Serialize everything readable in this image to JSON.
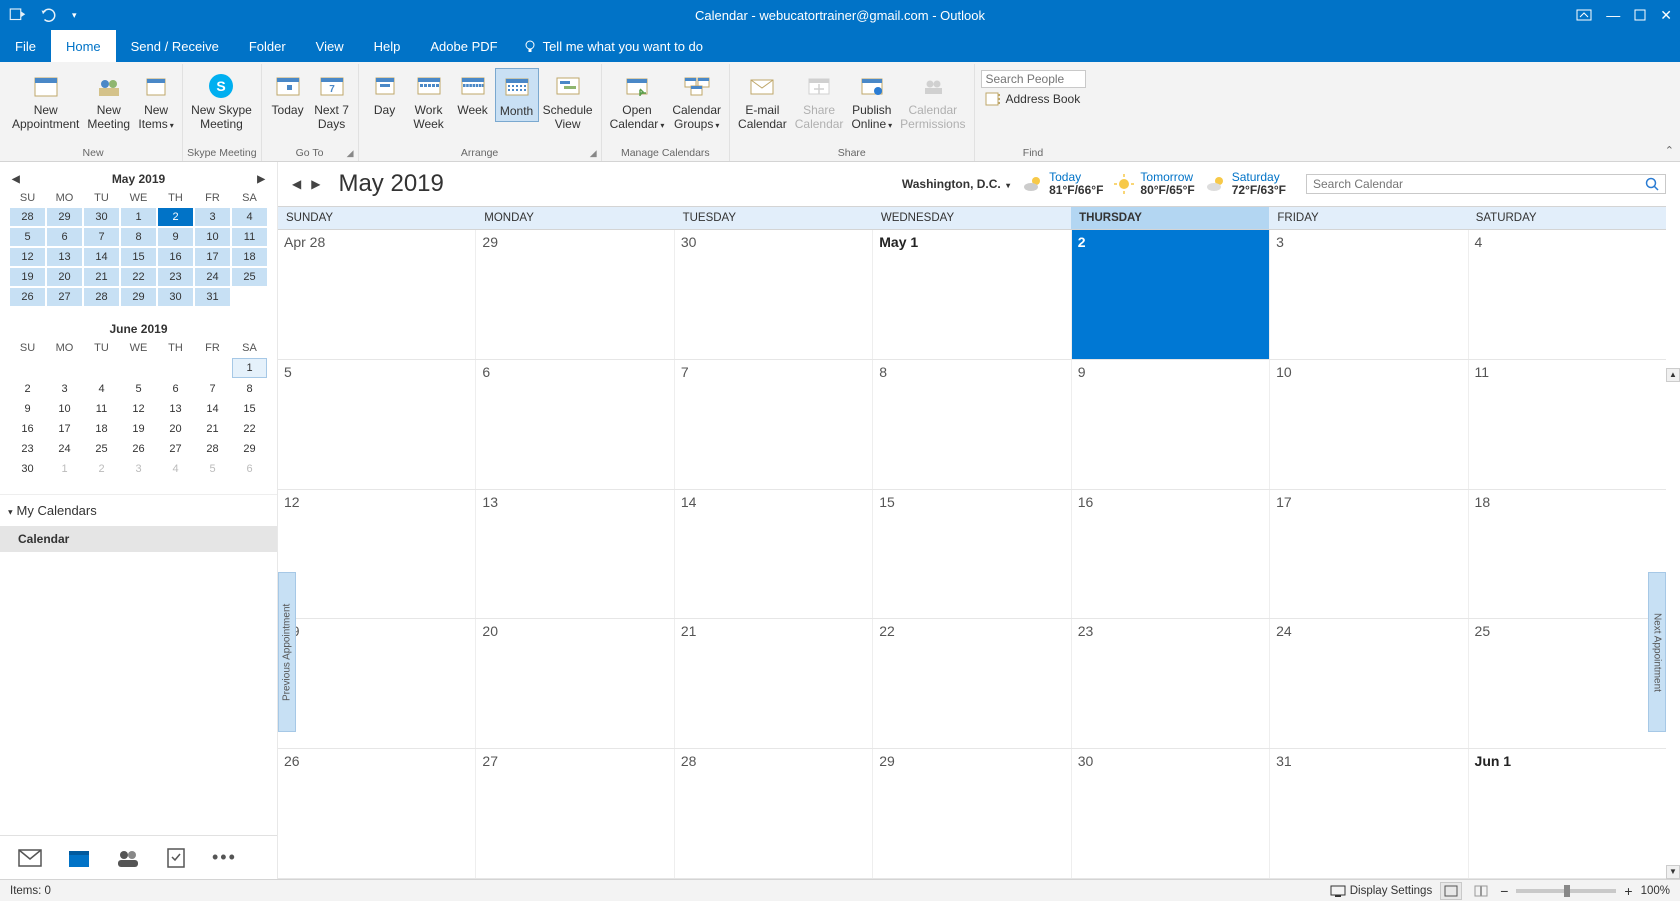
{
  "titlebar": {
    "title": "Calendar - webucatortrainer@gmail.com  -  Outlook"
  },
  "menu": {
    "tabs": [
      "File",
      "Home",
      "Send / Receive",
      "Folder",
      "View",
      "Help",
      "Adobe PDF"
    ],
    "active": 1,
    "tellme": "Tell me what you want to do"
  },
  "ribbon": {
    "groups": {
      "new": {
        "label": "New",
        "new_appt": "New\nAppointment",
        "new_meeting": "New\nMeeting",
        "new_items": "New\nItems"
      },
      "skype": {
        "label": "Skype Meeting",
        "new_skype": "New Skype\nMeeting"
      },
      "goto": {
        "label": "Go To",
        "today": "Today",
        "next7": "Next 7\nDays"
      },
      "arrange": {
        "label": "Arrange",
        "day": "Day",
        "workweek": "Work\nWeek",
        "week": "Week",
        "month": "Month",
        "schedule": "Schedule\nView"
      },
      "manage": {
        "label": "Manage Calendars",
        "open": "Open\nCalendar",
        "groups": "Calendar\nGroups"
      },
      "share": {
        "label": "Share",
        "email": "E-mail\nCalendar",
        "sharecal": "Share\nCalendar",
        "publish": "Publish\nOnline",
        "perms": "Calendar\nPermissions"
      },
      "find": {
        "label": "Find",
        "search_ph": "Search People",
        "address": "Address Book"
      }
    }
  },
  "mini1": {
    "title": "May 2019",
    "dow": [
      "SU",
      "MO",
      "TU",
      "WE",
      "TH",
      "FR",
      "SA"
    ],
    "rows": [
      [
        "28",
        "29",
        "30",
        "1",
        "2",
        "3",
        "4"
      ],
      [
        "5",
        "6",
        "7",
        "8",
        "9",
        "10",
        "11"
      ],
      [
        "12",
        "13",
        "14",
        "15",
        "16",
        "17",
        "18"
      ],
      [
        "19",
        "20",
        "21",
        "22",
        "23",
        "24",
        "25"
      ],
      [
        "26",
        "27",
        "28",
        "29",
        "30",
        "31",
        ""
      ]
    ]
  },
  "mini2": {
    "title": "June 2019",
    "rows": [
      [
        "",
        "",
        "",
        "",
        "",
        "",
        "1"
      ],
      [
        "2",
        "3",
        "4",
        "5",
        "6",
        "7",
        "8"
      ],
      [
        "9",
        "10",
        "11",
        "12",
        "13",
        "14",
        "15"
      ],
      [
        "16",
        "17",
        "18",
        "19",
        "20",
        "21",
        "22"
      ],
      [
        "23",
        "24",
        "25",
        "26",
        "27",
        "28",
        "29"
      ],
      [
        "30",
        "1",
        "2",
        "3",
        "4",
        "5",
        "6"
      ]
    ]
  },
  "mycals": {
    "header": "My Calendars",
    "item": "Calendar"
  },
  "cal": {
    "month": "May 2019",
    "location": "Washington,  D.C.",
    "forecast": [
      {
        "label": "Today",
        "temp": "81°F/66°F"
      },
      {
        "label": "Tomorrow",
        "temp": "80°F/65°F"
      },
      {
        "label": "Saturday",
        "temp": "72°F/63°F"
      }
    ],
    "search_ph": "Search Calendar",
    "days": [
      "SUNDAY",
      "MONDAY",
      "TUESDAY",
      "WEDNESDAY",
      "THURSDAY",
      "FRIDAY",
      "SATURDAY"
    ],
    "today_col": 4,
    "weeks": [
      [
        {
          "t": "Apr 28"
        },
        {
          "t": "29"
        },
        {
          "t": "30"
        },
        {
          "t": "May 1",
          "b": true
        },
        {
          "t": "2",
          "today": true
        },
        {
          "t": "3"
        },
        {
          "t": "4"
        }
      ],
      [
        {
          "t": "5"
        },
        {
          "t": "6"
        },
        {
          "t": "7"
        },
        {
          "t": "8"
        },
        {
          "t": "9"
        },
        {
          "t": "10"
        },
        {
          "t": "11"
        }
      ],
      [
        {
          "t": "12"
        },
        {
          "t": "13"
        },
        {
          "t": "14"
        },
        {
          "t": "15"
        },
        {
          "t": "16"
        },
        {
          "t": "17"
        },
        {
          "t": "18"
        }
      ],
      [
        {
          "t": "19"
        },
        {
          "t": "20"
        },
        {
          "t": "21"
        },
        {
          "t": "22"
        },
        {
          "t": "23"
        },
        {
          "t": "24"
        },
        {
          "t": "25"
        }
      ],
      [
        {
          "t": "26"
        },
        {
          "t": "27"
        },
        {
          "t": "28"
        },
        {
          "t": "29"
        },
        {
          "t": "30"
        },
        {
          "t": "31"
        },
        {
          "t": "Jun 1",
          "b": true
        }
      ]
    ],
    "prev_appt": "Previous Appointment",
    "next_appt": "Next Appointment"
  },
  "status": {
    "items": "Items: 0",
    "display": "Display Settings",
    "zoom": "100%"
  }
}
